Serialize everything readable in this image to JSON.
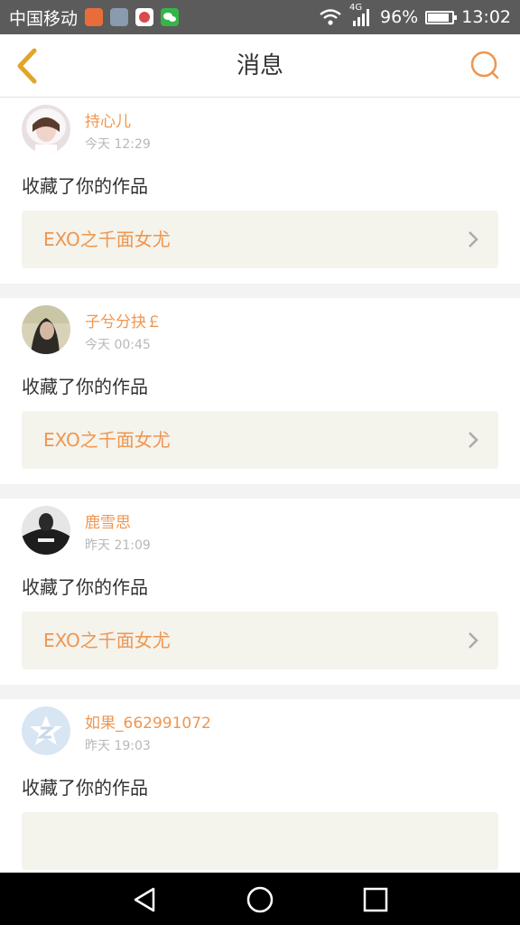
{
  "status_bar": {
    "carrier": "中国移动",
    "network_type": "4G",
    "battery": "96%",
    "battery_level": 0.96,
    "time": "13:02",
    "app_icons": [
      {
        "icon": "weibo-app-icon",
        "color": "#e86d3a"
      },
      {
        "icon": "gallery-app-icon",
        "color": "#8a9bb0"
      },
      {
        "icon": "qq-app-icon",
        "color": "#d94b4b"
      },
      {
        "icon": "wechat-app-icon",
        "color": "#35b549"
      }
    ]
  },
  "header": {
    "title": "消息",
    "back_icon": "back-chevron-icon",
    "search_icon": "search-icon"
  },
  "messages": [
    {
      "user": "持心儿",
      "time": "今天 12:29",
      "action": "收藏了你的作品",
      "work_title": "EXO之千面女尤",
      "avatar": "girl-white-hood"
    },
    {
      "user": "子兮分抉￡",
      "time": "今天 00:45",
      "action": "收藏了你的作品",
      "work_title": "EXO之千面女尤",
      "avatar": "girl-dark-hair"
    },
    {
      "user": "鹿雪思",
      "time": "昨天 21:09",
      "action": "收藏了你的作品",
      "work_title": "EXO之千面女尤",
      "avatar": "person-black-hoodie"
    },
    {
      "user": "如果_662991072",
      "time": "昨天 19:03",
      "action": "收藏了你的作品",
      "work_title": "",
      "avatar": "qzone-default"
    }
  ],
  "colors": {
    "accent": "#ef9650",
    "header_icon": "#e0a52a",
    "card_bg": "#f4f3ec",
    "status_bar_bg": "#5b5b5b"
  },
  "nav_bar": {
    "back_icon": "nav-back-triangle-icon",
    "home_icon": "nav-home-circle-icon",
    "recent_icon": "nav-recent-square-icon"
  }
}
